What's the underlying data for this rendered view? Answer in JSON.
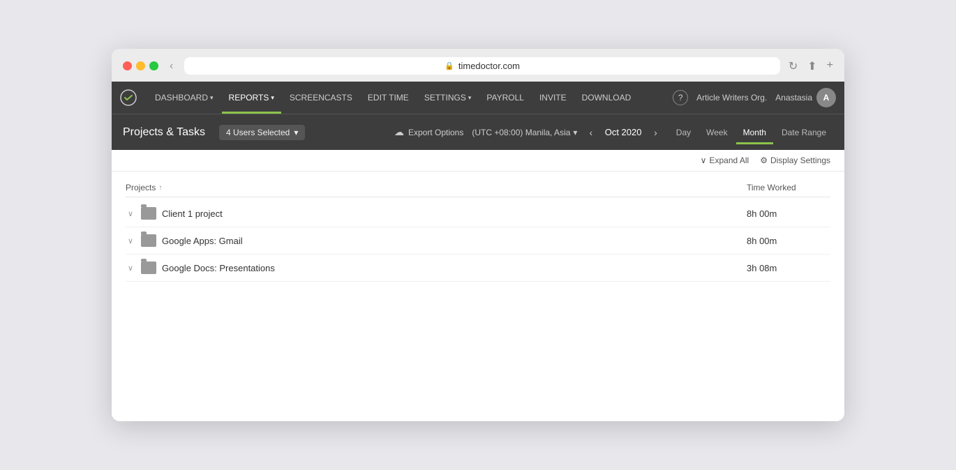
{
  "browser": {
    "url": "timedoctor.com",
    "back_icon": "‹",
    "refresh_icon": "↻",
    "share_icon": "⬆",
    "add_icon": "+"
  },
  "topnav": {
    "logo_icon": "✓",
    "items": [
      {
        "label": "DASHBOARD",
        "has_arrow": true,
        "active": false
      },
      {
        "label": "REPORTS",
        "has_arrow": true,
        "active": true
      },
      {
        "label": "SCREENCASTS",
        "has_arrow": false,
        "active": false
      },
      {
        "label": "EDIT TIME",
        "has_arrow": false,
        "active": false
      },
      {
        "label": "SETTINGS",
        "has_arrow": true,
        "active": false
      },
      {
        "label": "PAYROLL",
        "has_arrow": false,
        "active": false
      },
      {
        "label": "INVITE",
        "has_arrow": false,
        "active": false
      },
      {
        "label": "DOWNLOAD",
        "has_arrow": false,
        "active": false
      }
    ],
    "help_label": "?",
    "org_label": "Article Writers Org.",
    "user_label": "Anastasia",
    "avatar_initials": "A"
  },
  "subheader": {
    "page_title": "Projects & Tasks",
    "users_selected": "4 Users Selected",
    "export_label": "Export Options",
    "timezone_label": "(UTC +08:00) Manila, Asia",
    "date_label": "Oct 2020",
    "period_tabs": [
      {
        "label": "Day",
        "active": false
      },
      {
        "label": "Week",
        "active": false
      },
      {
        "label": "Month",
        "active": true
      },
      {
        "label": "Date Range",
        "active": false
      }
    ]
  },
  "toolbar": {
    "expand_all_label": "Expand All",
    "display_settings_label": "Display Settings"
  },
  "table": {
    "col_projects": "Projects",
    "col_time": "Time Worked",
    "sort_arrow": "↑",
    "rows": [
      {
        "name": "Client 1 project",
        "time": "8h 00m"
      },
      {
        "name": "Google Apps: Gmail",
        "time": "8h 00m"
      },
      {
        "name": "Google Docs: Presentations",
        "time": "3h 08m"
      }
    ]
  }
}
